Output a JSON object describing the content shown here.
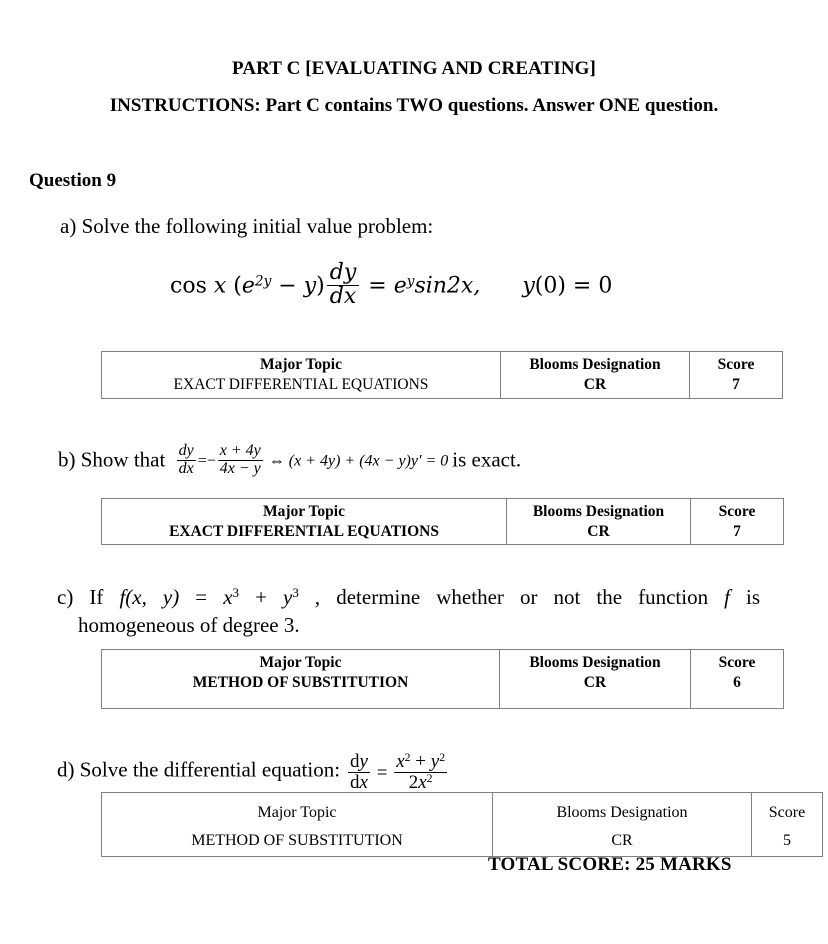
{
  "header": {
    "part_title": "PART C [EVALUATING AND CREATING]",
    "instructions": "INSTRUCTIONS: Part C contains TWO questions. Answer ONE question."
  },
  "question": {
    "label": "Question 9",
    "total_score": "TOTAL SCORE: 25 MARKS"
  },
  "items": {
    "a": {
      "marker": "a)",
      "text": "Solve the following initial value problem:",
      "equation_plain": "cos x (e^{2y} − y) dy/dx = e^y sin2x,    y(0) = 0",
      "eq": {
        "cos": "cos",
        "x": "x",
        "open": "(",
        "e": "e",
        "exp_2y": "2y",
        "minus": "−",
        "y": "y",
        "close": ")",
        "num": "dy",
        "den": "dx",
        "equals": "=",
        "e2": "e",
        "exp_y": "y",
        "sin": "sin2x,",
        "ic_y": "y",
        "ic_open": "(0)",
        "ic_equals": "=",
        "ic_zero": "0"
      }
    },
    "b": {
      "marker": "b)",
      "text_before": "Show that",
      "text_after": "is exact.",
      "equation_plain": "dy/dx = −(x+4y)/(4x−y) ⇔ (x+4y)+(4x−y)y′ = 0",
      "eq": {
        "num": "dy",
        "den": "dx",
        "equals": "=",
        "neg": "−",
        "fnum": "x + 4y",
        "fden": "4x − y",
        "iff": "⇔",
        "rhs": "(x + 4y) + (4x − y)y′ = 0"
      }
    },
    "c": {
      "marker": "c)",
      "line1_plain": "If f(x, y) = x³ + y³ , determine whether or not the function f is",
      "line2": "homogeneous of degree 3.",
      "eq": {
        "if": "If",
        "f": "f",
        "args": "(x, y)",
        "equals": "=",
        "x": "x",
        "exp3a": "3",
        "plus": "+",
        "y": "y",
        "exp3b": "3",
        "comma": ",",
        "tail_before_f": "determine whether or not the function",
        "f2": "f",
        "tail_after_f": "is"
      }
    },
    "d": {
      "marker": "d)",
      "text": "Solve the differential equation:",
      "equation_plain": "dy/dx = (x² + y²)/(2x²)",
      "eq": {
        "num_d": "d",
        "num_y": "y",
        "den_d": "d",
        "den_x": "x",
        "equals": "=",
        "fnum_x": "x",
        "fnum_exp": "2",
        "fnum_plus": "+",
        "fnum_y": "y",
        "fnum_exp2": "2",
        "fden_2": "2",
        "fden_x": "x",
        "fden_exp": "2"
      }
    }
  },
  "tables": {
    "columns": [
      "Major Topic",
      "Blooms Designation",
      "Score"
    ],
    "rows": [
      {
        "id": "a",
        "major_topic": "EXACT DIFFERENTIAL EQUATIONS",
        "blooms": "CR",
        "score": "7"
      },
      {
        "id": "b",
        "major_topic": "EXACT DIFFERENTIAL EQUATIONS",
        "blooms": "CR",
        "score": "7"
      },
      {
        "id": "c",
        "major_topic": "METHOD OF SUBSTITUTION",
        "blooms": "CR",
        "score": "6"
      },
      {
        "id": "d",
        "major_topic": "METHOD OF SUBSTITUTION",
        "blooms": "CR",
        "score": "5"
      }
    ]
  },
  "colors": {
    "text": "#000000",
    "table_border": "#808080",
    "background": "#ffffff"
  }
}
